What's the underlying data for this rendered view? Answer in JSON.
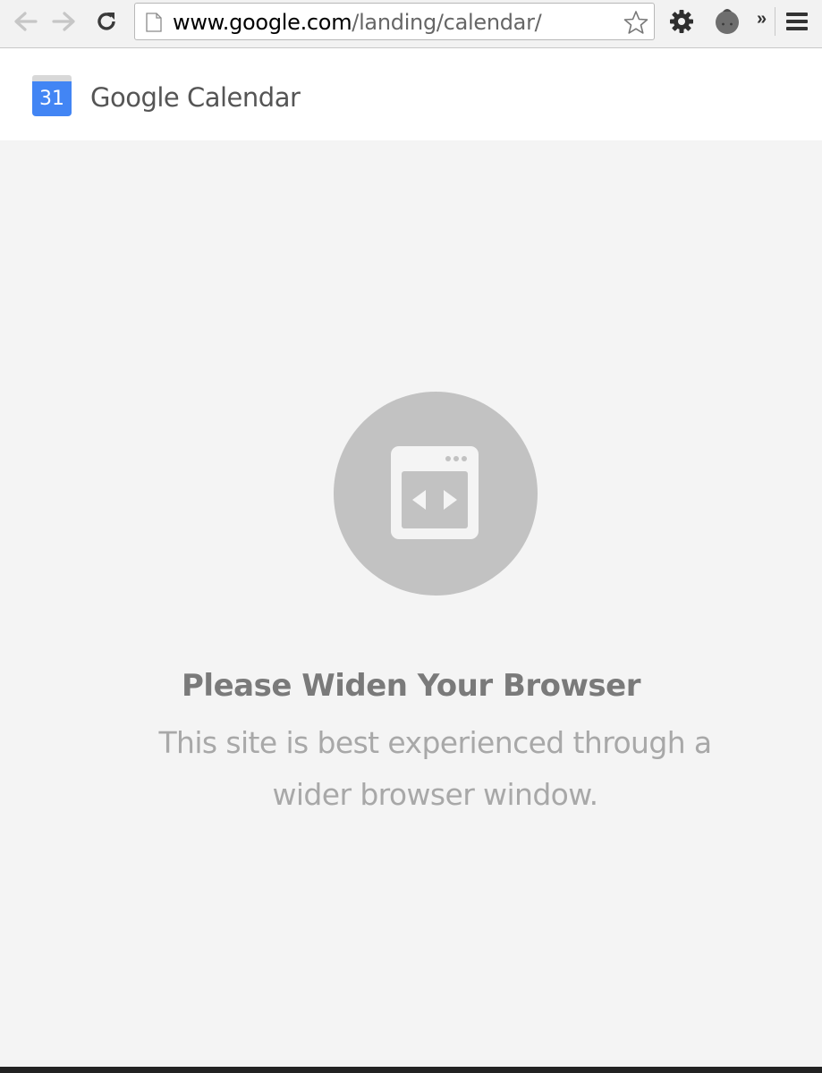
{
  "browser": {
    "url_domain": "www.google.com",
    "url_path": "/landing/calendar/",
    "overflow_label": "»"
  },
  "header": {
    "logo_day": "31",
    "app_title": "Google Calendar"
  },
  "main": {
    "heading": "Please Widen Your Browser",
    "message": "This site is best experienced through a wider browser window."
  },
  "colors": {
    "calendar_blue": "#4285f4",
    "icon_circle": "#c2c2c2",
    "background": "#f4f4f4"
  },
  "icons": [
    "back-arrow-icon",
    "forward-arrow-icon",
    "reload-icon",
    "page-icon",
    "star-icon",
    "gear-icon",
    "extension-icon",
    "menu-icon",
    "widen-browser-icon"
  ]
}
